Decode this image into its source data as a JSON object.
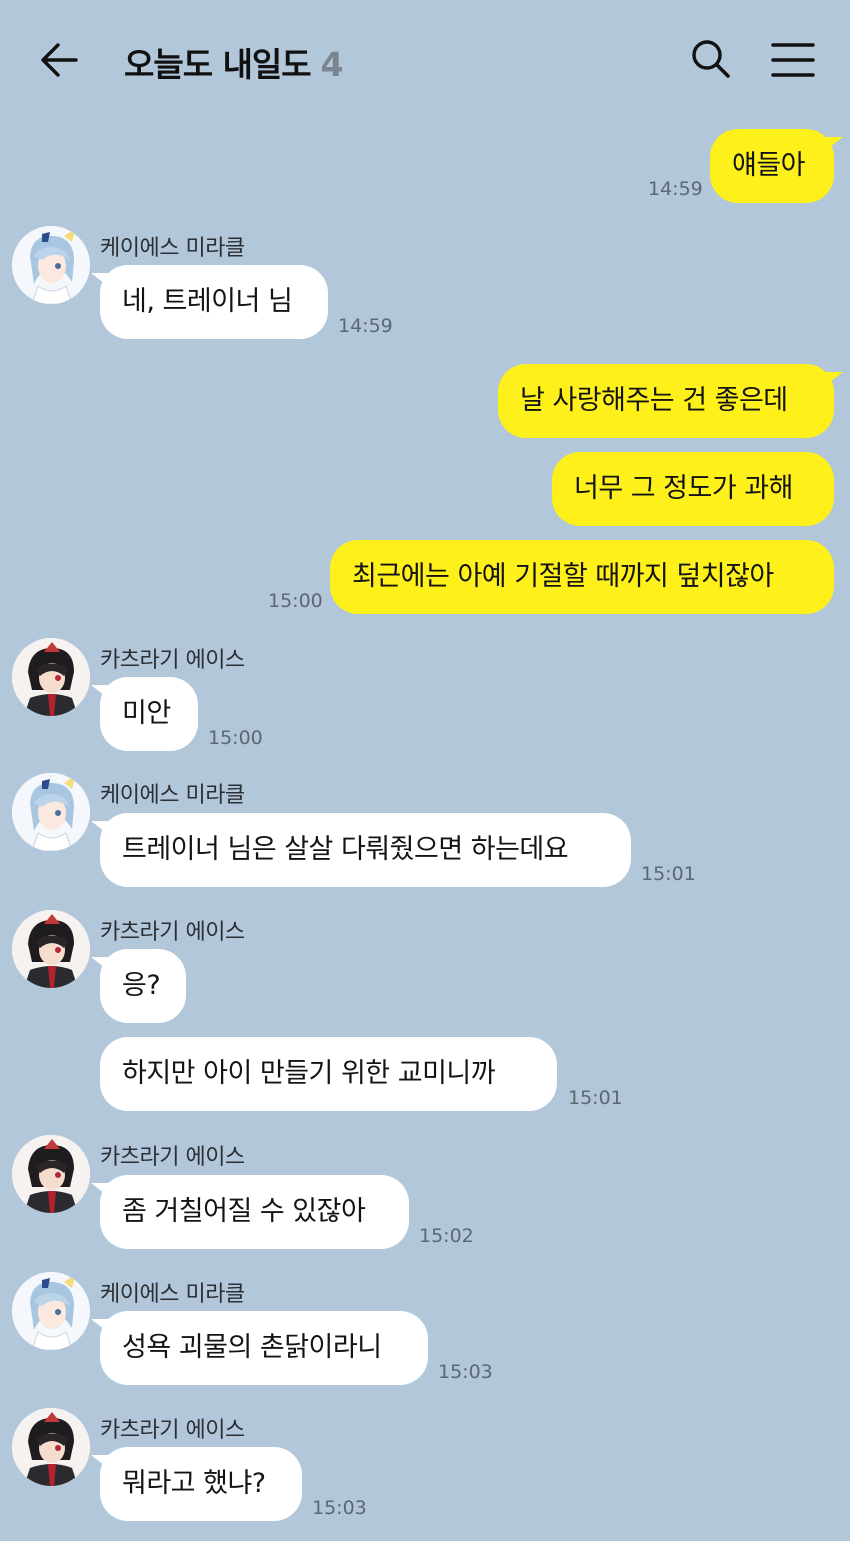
{
  "header": {
    "title": "오늘도 내일도",
    "member_count": "4"
  },
  "messages": [
    {
      "from": "me",
      "text": "얘들아",
      "time": "14:59"
    },
    {
      "from": "케이에스 미라클",
      "text": "네, 트레이너 님",
      "time": "14:59"
    },
    {
      "from": "me",
      "text": "날 사랑해주는 건 좋은데"
    },
    {
      "from": "me",
      "text": "너무 그 정도가 과해"
    },
    {
      "from": "me",
      "text": "최근에는 아예 기절할 때까지 덮치잖아",
      "time": "15:00"
    },
    {
      "from": "카츠라기 에이스",
      "text": "미안",
      "time": "15:00"
    },
    {
      "from": "케이에스 미라클",
      "text": "트레이너 님은 살살 다뤄줬으면 하는데요",
      "time": "15:01"
    },
    {
      "from": "카츠라기 에이스",
      "text": "응?"
    },
    {
      "from": "카츠라기 에이스",
      "text": "하지만 아이 만들기 위한 교미니까",
      "time": "15:01"
    },
    {
      "from": "카츠라기 에이스",
      "text": "좀 거칠어질 수 있잖아",
      "time": "15:02"
    },
    {
      "from": "케이에스 미라클",
      "text": "성욕 괴물의 촌닭이라니",
      "time": "15:03"
    },
    {
      "from": "카츠라기 에이스",
      "text": "뭐라고 했냐?",
      "time": "15:03"
    }
  ],
  "colors": {
    "background": "#b2c7da",
    "my_bubble": "#fef01b",
    "other_bubble": "#ffffff"
  },
  "icons": [
    "back-arrow-icon",
    "search-icon",
    "menu-icon"
  ]
}
